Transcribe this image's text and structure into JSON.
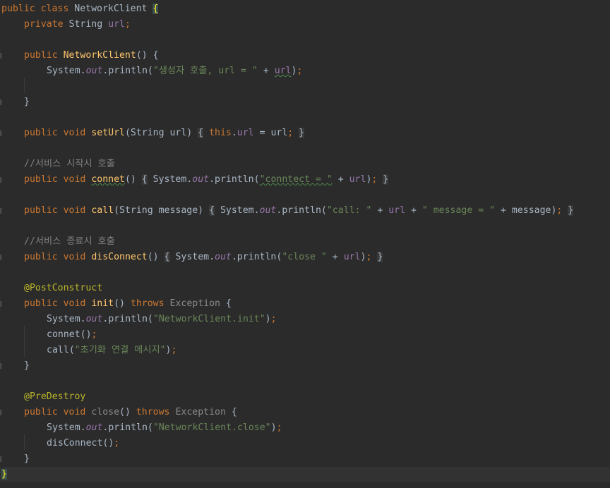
{
  "colors": {
    "background": "#2b2b2b",
    "keyword": "#cc7832",
    "function": "#ffc66d",
    "string": "#6a8759",
    "field": "#9876aa",
    "comment": "#808080",
    "annotation": "#bbb529",
    "text": "#a9b7c6"
  },
  "code": {
    "l1": {
      "k1": "public",
      "k2": "class",
      "name": "NetworkClient",
      "brace": "{"
    },
    "l2": {
      "k1": "private",
      "type": "String",
      "field": "url",
      "semi": ";"
    },
    "l4": {
      "k1": "public",
      "name": "NetworkClient",
      "rest": "() {"
    },
    "l5": {
      "a": "System.",
      "out": "out",
      "b": ".println(",
      "str": "\"생성자 호출, url = \"",
      "c": " + ",
      "field": "url",
      "d": ")",
      "semi": ";"
    },
    "l7": {
      "brace": "}"
    },
    "l9": {
      "k1": "public",
      "k2": "void",
      "name": "setUrl",
      "params": "(String url) ",
      "ob": "{",
      "k3": "this",
      "dot": ".",
      "field": "url",
      "mid": " = url",
      "semi": ";",
      "cb": "}"
    },
    "l11": {
      "comment": "//서비스 시작시 호출"
    },
    "l12": {
      "k1": "public",
      "k2": "void",
      "name": "connet",
      "p": "() ",
      "ob": "{",
      "a": " System.",
      "out": "out",
      "b": ".println(",
      "str": "\"conntect = \"",
      "c": " + ",
      "field": "url",
      "d": ")",
      "semi": ";",
      "cb": "}"
    },
    "l14": {
      "k1": "public",
      "k2": "void",
      "name": "call",
      "params": "(String message) ",
      "ob": "{",
      "a": " System.",
      "out": "out",
      "b": ".println(",
      "str1": "\"call: \"",
      "c1": " + ",
      "field": "url",
      "c2": " + ",
      "str2": "\" message = \"",
      "c3": " + message)",
      "semi": ";",
      "cb": "}"
    },
    "l16": {
      "comment": "//서비스 종료시 호출"
    },
    "l17": {
      "k1": "public",
      "k2": "void",
      "name": "disConnect",
      "p": "() ",
      "ob": "{",
      "a": " System.",
      "out": "out",
      "b": ".println(",
      "str": "\"close \"",
      "c": " + ",
      "field": "url",
      "d": ")",
      "semi": ";",
      "cb": "}"
    },
    "l19": {
      "ann": "@PostConstruct"
    },
    "l20": {
      "k1": "public",
      "k2": "void",
      "name": "init",
      "p": "() ",
      "k3": "throws",
      "exc": "Exception",
      "rest": " {"
    },
    "l21": {
      "a": "System.",
      "out": "out",
      "b": ".println(",
      "str": "\"NetworkClient.init\"",
      "d": ")",
      "semi": ";"
    },
    "l22": {
      "call": "connet()",
      "semi": ";"
    },
    "l23": {
      "a": "call(",
      "str": "\"초기화 연결 메시지\"",
      "d": ")",
      "semi": ";"
    },
    "l24": {
      "brace": "}"
    },
    "l26": {
      "ann": "@PreDestroy"
    },
    "l27": {
      "k1": "public",
      "k2": "void",
      "name": "close",
      "p": "() ",
      "k3": "throws",
      "exc": "Exception",
      "rest": " {"
    },
    "l28": {
      "a": "System.",
      "out": "out",
      "b": ".println(",
      "str": "\"NetworkClient.close\"",
      "d": ")",
      "semi": ";"
    },
    "l29": {
      "call": "disConnect()",
      "semi": ";"
    },
    "l30": {
      "brace": "}"
    },
    "l31": {
      "brace": "}"
    }
  }
}
